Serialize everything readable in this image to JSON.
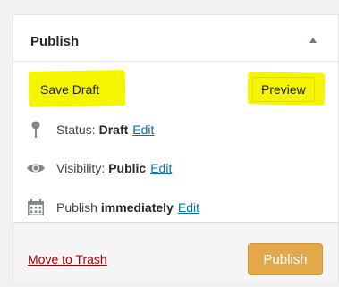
{
  "box": {
    "title": "Publish"
  },
  "actions": {
    "save_draft": "Save Draft",
    "preview": "Preview"
  },
  "status": {
    "label": "Status:",
    "value": "Draft",
    "edit": "Edit"
  },
  "visibility": {
    "label": "Visibility:",
    "value": "Public",
    "edit": "Edit"
  },
  "schedule": {
    "label": "Publish",
    "value": "immediately",
    "edit": "Edit"
  },
  "footer": {
    "trash": "Move to Trash",
    "publish": "Publish"
  },
  "icons": {
    "toggle": "triangle-up-icon",
    "status": "pin-icon",
    "visibility": "eye-icon",
    "schedule": "calendar-icon"
  },
  "colors": {
    "highlight": "#f5f500",
    "link": "#0073aa",
    "trash": "#aa0000",
    "publish_button": "#e2a849"
  }
}
